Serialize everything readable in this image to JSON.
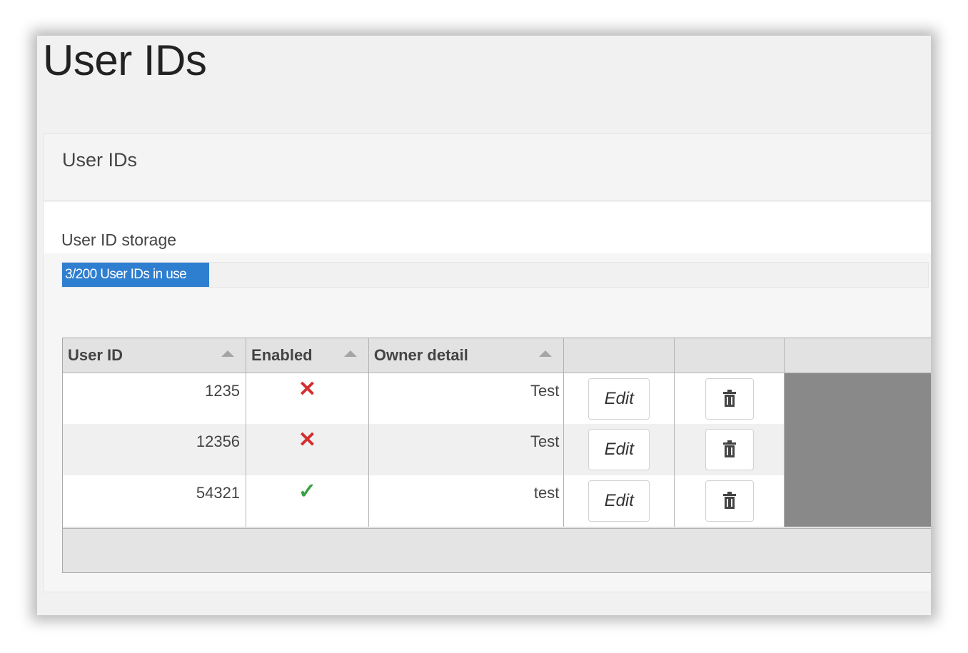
{
  "page": {
    "title": "User IDs"
  },
  "panel": {
    "heading": "User IDs",
    "storage_label": "User ID storage",
    "storage_text": "3/200 User IDs in use",
    "storage_used": 3,
    "storage_total": 200
  },
  "table": {
    "columns": [
      "User ID",
      "Enabled",
      "Owner detail",
      "",
      "",
      ""
    ],
    "rows": [
      {
        "user_id": "1235",
        "enabled": false,
        "enabled_icon": "x-icon",
        "owner": "Test",
        "edit_label": "Edit",
        "delete_icon": "trash-icon"
      },
      {
        "user_id": "12356",
        "enabled": false,
        "enabled_icon": "x-icon",
        "owner": "Test",
        "edit_label": "Edit",
        "delete_icon": "trash-icon"
      },
      {
        "user_id": "54321",
        "enabled": true,
        "enabled_icon": "check-icon",
        "owner": "test",
        "edit_label": "Edit",
        "delete_icon": "trash-icon"
      }
    ]
  },
  "colors": {
    "progress": "#2f7fd0",
    "disabled": "#d32f2f",
    "enabled": "#3aa043"
  }
}
